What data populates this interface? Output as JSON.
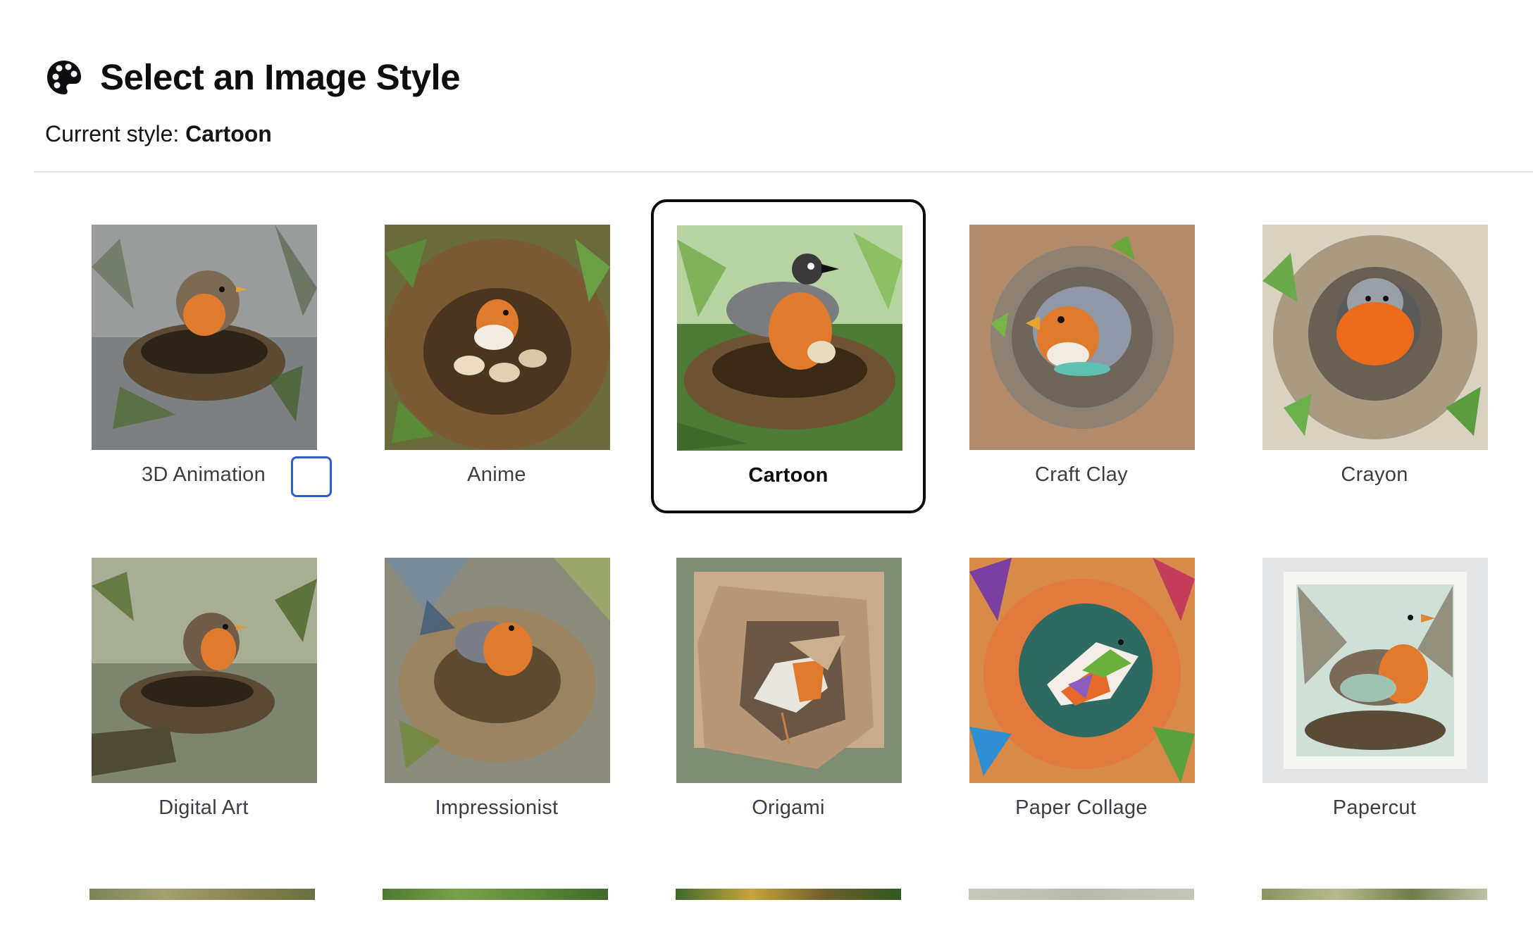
{
  "header": {
    "title": "Select an Image Style",
    "icon": "palette-icon",
    "current_style_prefix": "Current style:",
    "current_style_value": "Cartoon"
  },
  "styles": [
    {
      "label": "3D Animation"
    },
    {
      "label": "Anime"
    },
    {
      "label": "Cartoon",
      "selected": true
    },
    {
      "label": "Craft Clay"
    },
    {
      "label": "Crayon"
    },
    {
      "label": "Digital Art"
    },
    {
      "label": "Impressionist"
    },
    {
      "label": "Origami"
    },
    {
      "label": "Paper Collage"
    },
    {
      "label": "Papercut"
    }
  ],
  "colors": {
    "selected_border": "#0c0c0c",
    "focus_ring": "#2d5bd0",
    "divider": "#e4e6ea",
    "label_text": "#3a3f47",
    "robin_orange": "#e07a2c"
  }
}
